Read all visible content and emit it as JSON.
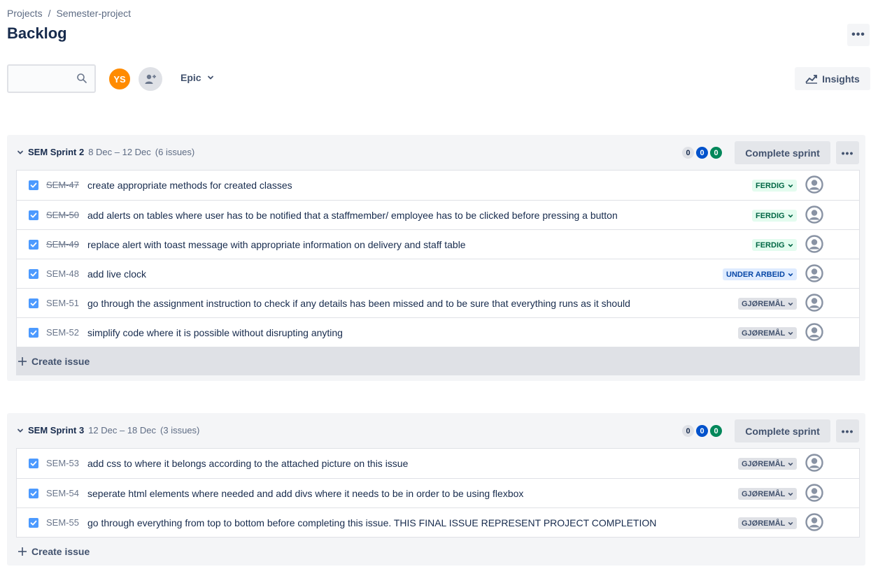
{
  "breadcrumb": {
    "projects": "Projects",
    "separator": "/",
    "project": "Semester-project"
  },
  "page": {
    "title": "Backlog",
    "more": "•••"
  },
  "toolbar": {
    "search_placeholder": "",
    "avatar_initials": "YS",
    "epic_label": "Epic",
    "insights_label": "Insights"
  },
  "icons": {
    "search": "search-icon",
    "add_person": "add-person-icon",
    "chevron": "chevron-down-icon",
    "insights": "line-chart-icon",
    "assignee": "default-avatar-icon",
    "checkbox": "checkbox-checked-icon"
  },
  "colors": {
    "avatar": "#ff8b00",
    "done": "#006644",
    "in_progress": "#0747a6",
    "todo": "#42526e",
    "blue_counter": "#0052cc",
    "green_counter": "#00875a"
  },
  "sprints": [
    {
      "name": "SEM Sprint 2",
      "dates": "8 Dec – 12 Dec",
      "count": "(6 issues)",
      "counters": [
        "0",
        "0",
        "0"
      ],
      "complete_label": "Complete sprint",
      "more": "•••",
      "create_label": "Create issue",
      "issues": [
        {
          "key": "SEM-47",
          "summary": "create appropriate methods for created classes",
          "status": "FERDIG",
          "kind": "done"
        },
        {
          "key": "SEM-50",
          "summary": "add alerts on tables where user has to be notified that a staffmember/ employee has to be clicked before pressing a button",
          "status": "FERDIG",
          "kind": "done"
        },
        {
          "key": "SEM-49",
          "summary": "replace alert with toast message with appropriate information on delivery and staff table",
          "status": "FERDIG",
          "kind": "done"
        },
        {
          "key": "SEM-48",
          "summary": "add live clock",
          "status": "UNDER ARBEID",
          "kind": "progress"
        },
        {
          "key": "SEM-51",
          "summary": "go through the assignment instruction to check if any details has been missed and to be sure that everything runs as it should",
          "status": "GJØREMÅL",
          "kind": "todo"
        },
        {
          "key": "SEM-52",
          "summary": "simplify code where it is possible without disrupting anyting",
          "status": "GJØREMÅL",
          "kind": "todo"
        }
      ]
    },
    {
      "name": "SEM Sprint 3",
      "dates": "12 Dec – 18 Dec",
      "count": "(3 issues)",
      "counters": [
        "0",
        "0",
        "0"
      ],
      "complete_label": "Complete sprint",
      "more": "•••",
      "create_label": "Create issue",
      "issues": [
        {
          "key": "SEM-53",
          "summary": "add css to where it belongs according to the attached picture on this issue",
          "status": "GJØREMÅL",
          "kind": "todo"
        },
        {
          "key": "SEM-54",
          "summary": "seperate html elements where needed and add divs where it needs to be in order to be using flexbox",
          "status": "GJØREMÅL",
          "kind": "todo"
        },
        {
          "key": "SEM-55",
          "summary": "go through everything from top to bottom before completing this issue. THIS FINAL ISSUE REPRESENT PROJECT COMPLETION",
          "status": "GJØREMÅL",
          "kind": "todo"
        }
      ]
    }
  ]
}
